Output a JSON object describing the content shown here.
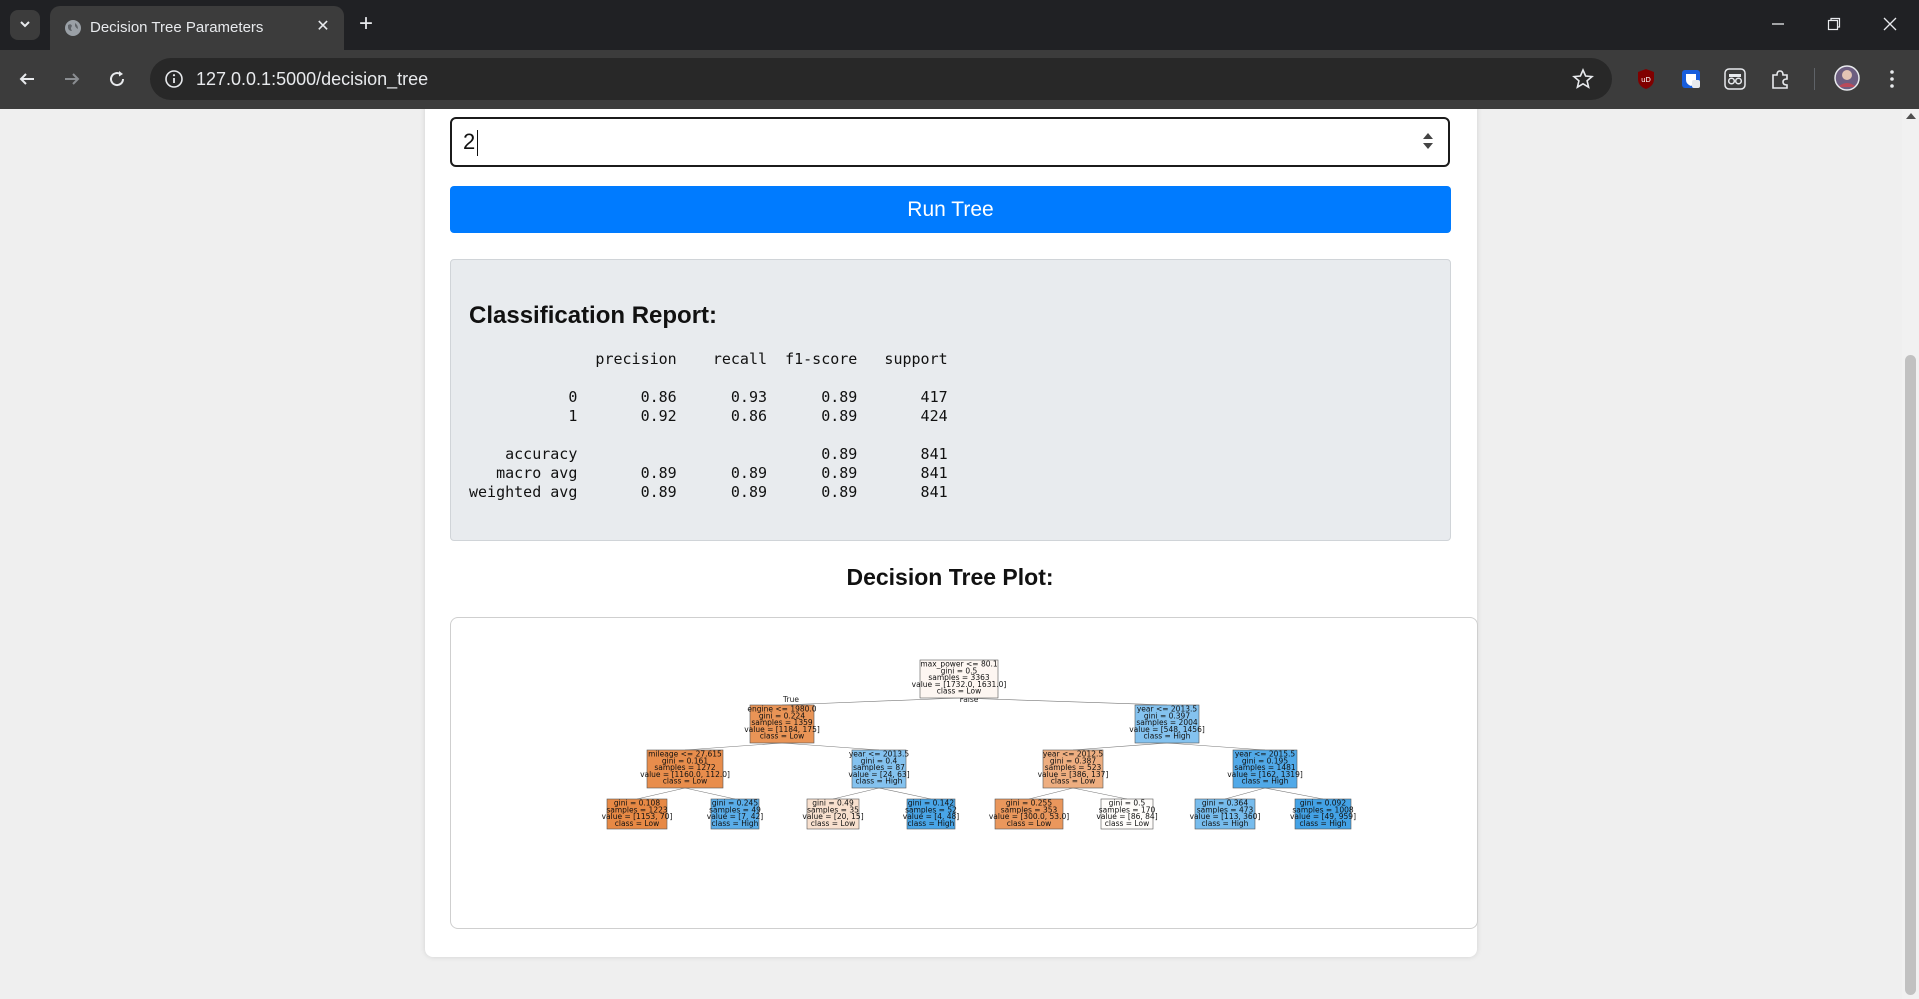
{
  "browser": {
    "tab_title": "Decision Tree Parameters",
    "url": "127.0.0.1:5000/decision_tree",
    "new_tab_symbol": "+",
    "close_symbol": "✕",
    "extension_ublock_text": "uD"
  },
  "form": {
    "number_value": "2",
    "run_button_label": "Run Tree"
  },
  "report": {
    "title": "Classification Report:",
    "text": "              precision    recall  f1-score   support\n\n           0       0.86      0.93      0.89       417\n           1       0.92      0.86      0.89       424\n\n    accuracy                           0.89       841\n   macro avg       0.89      0.89      0.89       841\nweighted avg       0.89      0.89      0.89       841"
  },
  "plot": {
    "heading": "Decision Tree Plot:",
    "edge_true": "True",
    "edge_false": "False",
    "colors": {
      "low_strong": "#e58139",
      "low_light": "#f9e1d0",
      "low_faint": "#fdf6f1",
      "high_strong": "#399de5",
      "high_mid": "#7bbeee",
      "neutral": "#ffffff"
    },
    "nodes": [
      {
        "id": "n0",
        "lines": [
          "max_power <= 80.1",
          "gini = 0.5",
          "samples = 3363",
          "value = [1732.0, 1631.0]",
          "class = Low"
        ],
        "fill": "#fdf6f1"
      },
      {
        "id": "n1",
        "lines": [
          "engine <= 1980.0",
          "gini = 0.224",
          "samples = 1359",
          "value = [1184, 175]",
          "class = Low"
        ],
        "fill": "#e99456"
      },
      {
        "id": "n2",
        "lines": [
          "year <= 2013.5",
          "gini = 0.397",
          "samples = 2004",
          "value = [548, 1456]",
          "class = High"
        ],
        "fill": "#84c2ef"
      },
      {
        "id": "n3",
        "lines": [
          "mileage <= 27.615",
          "gini = 0.161",
          "samples = 1272",
          "value = [1160.0, 112.0]",
          "class = Low"
        ],
        "fill": "#e88d4c"
      },
      {
        "id": "n4",
        "lines": [
          "year <= 2013.5",
          "gini = 0.4",
          "samples = 87",
          "value = [24, 63]",
          "class = High"
        ],
        "fill": "#84c2ef"
      },
      {
        "id": "n5",
        "lines": [
          "year <= 2012.5",
          "gini = 0.387",
          "samples = 523",
          "value = [386, 137]",
          "class = Low"
        ],
        "fill": "#eeae80"
      },
      {
        "id": "n6",
        "lines": [
          "year <= 2015.5",
          "gini = 0.195",
          "samples = 1481",
          "value = [162, 1319]",
          "class = High"
        ],
        "fill": "#51a9e8"
      },
      {
        "id": "n7",
        "lines": [
          "gini = 0.108",
          "samples = 1223",
          "value = [1153, 70]",
          "class = Low"
        ],
        "fill": "#e78945"
      },
      {
        "id": "n8",
        "lines": [
          "gini = 0.245",
          "samples = 49",
          "value = [7, 42]",
          "class = High"
        ],
        "fill": "#5aade9"
      },
      {
        "id": "n9",
        "lines": [
          "gini = 0.49",
          "samples = 35",
          "value = [20, 15]",
          "class = Low"
        ],
        "fill": "#f8e0ce"
      },
      {
        "id": "n10",
        "lines": [
          "gini = 0.142",
          "samples = 52",
          "value = [4, 48]",
          "class = High"
        ],
        "fill": "#49a5e7"
      },
      {
        "id": "n11",
        "lines": [
          "gini = 0.255",
          "samples = 353",
          "value = [300.0, 53.0]",
          "class = Low"
        ],
        "fill": "#ea975c"
      },
      {
        "id": "n12",
        "lines": [
          "gini = 0.5",
          "samples = 170",
          "value = [86, 84]",
          "class = Low"
        ],
        "fill": "#fefcfa"
      },
      {
        "id": "n13",
        "lines": [
          "gini = 0.364",
          "samples = 473",
          "value = [113, 360]",
          "class = High"
        ],
        "fill": "#77bced"
      },
      {
        "id": "n14",
        "lines": [
          "gini = 0.092",
          "samples = 1008",
          "value = [49, 959]",
          "class = High"
        ],
        "fill": "#43a2e6"
      }
    ],
    "edges": [
      [
        "n0",
        "n1"
      ],
      [
        "n0",
        "n2"
      ],
      [
        "n1",
        "n3"
      ],
      [
        "n1",
        "n4"
      ],
      [
        "n2",
        "n5"
      ],
      [
        "n2",
        "n6"
      ],
      [
        "n3",
        "n7"
      ],
      [
        "n3",
        "n8"
      ],
      [
        "n4",
        "n9"
      ],
      [
        "n4",
        "n10"
      ],
      [
        "n5",
        "n11"
      ],
      [
        "n5",
        "n12"
      ],
      [
        "n6",
        "n13"
      ],
      [
        "n6",
        "n14"
      ]
    ]
  }
}
